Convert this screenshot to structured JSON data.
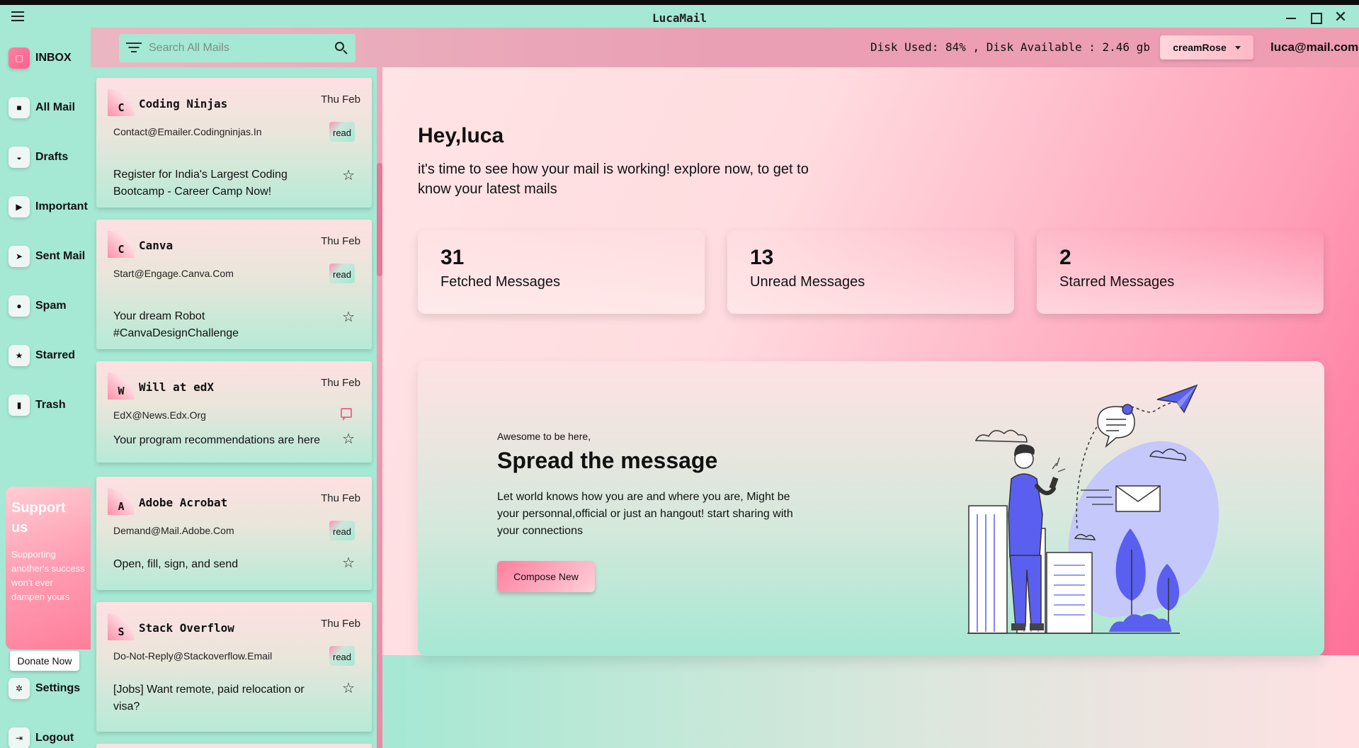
{
  "window": {
    "title": "LucaMail",
    "close_glyph": "✕"
  },
  "sidebar": {
    "items": [
      {
        "label": "INBOX",
        "icon": "inbox-icon",
        "glyph": "▢"
      },
      {
        "label": "All Mail",
        "icon": "folder-icon",
        "glyph": "■"
      },
      {
        "label": "Drafts",
        "icon": "drafts-icon",
        "glyph": "◒"
      },
      {
        "label": "Important",
        "icon": "important-icon",
        "glyph": "▶"
      },
      {
        "label": "Sent Mail",
        "icon": "send-icon",
        "glyph": "➤"
      },
      {
        "label": "Spam",
        "icon": "spam-icon",
        "glyph": "●"
      },
      {
        "label": "Starred",
        "icon": "star-icon",
        "glyph": "★"
      },
      {
        "label": "Trash",
        "icon": "trash-icon",
        "glyph": "▮"
      }
    ],
    "support": {
      "title": "Support us",
      "text": "Supporting another's success won't ever dampen yours",
      "button": "Donate Now"
    },
    "settings": {
      "label": "Settings",
      "icon": "gear-icon",
      "glyph": "✲"
    },
    "logout": {
      "label": "Logout",
      "icon": "logout-icon",
      "glyph": "⇥"
    }
  },
  "header": {
    "search_placeholder": "Search All Mails",
    "disk_info": "Disk Used: 84% , Disk Available : 2.46 gb",
    "theme": "creamRose",
    "user_email": "luca@mail.com"
  },
  "mails": [
    {
      "initial": "C",
      "sender": "Coding Ninjas",
      "date": "Thu Feb",
      "from": "Contact@Emailer.Codingninjas.In",
      "status": "read",
      "subject": "Register for India's Largest Coding Bootcamp - Career Camp Now!",
      "star": "☆"
    },
    {
      "initial": "C",
      "sender": "Canva",
      "date": "Thu Feb",
      "from": "Start@Engage.Canva.Com",
      "status": "read",
      "subject": "Your dream Robot #CanvaDesignChallenge",
      "star": "☆"
    },
    {
      "initial": "W",
      "sender": "Will at edX",
      "date": "Thu Feb",
      "from": "EdX@News.Edx.Org",
      "status": "",
      "subject": "Your program recommendations are here",
      "star": "☆"
    },
    {
      "initial": "A",
      "sender": "Adobe Acrobat",
      "date": "Thu Feb",
      "from": "Demand@Mail.Adobe.Com",
      "status": "read",
      "subject": "Open, fill, sign, and send",
      "star": "☆"
    },
    {
      "initial": "S",
      "sender": "Stack Overflow",
      "date": "Thu Feb",
      "from": "Do-Not-Reply@Stackoverflow.Email",
      "status": "read",
      "subject": "[Jobs] Want remote, paid relocation or visa?",
      "star": "☆"
    }
  ],
  "main": {
    "greeting": "Hey,luca",
    "subtitle": "it's time to see how your mail is working! explore now, to get to know your latest mails",
    "stats": [
      {
        "value": "31",
        "label": "Fetched Messages"
      },
      {
        "value": "13",
        "label": "Unread Messages"
      },
      {
        "value": "2",
        "label": "Starred Messages"
      }
    ],
    "promo": {
      "kicker": "Awesome to be here,",
      "title": "Spread the message",
      "body": "Let world knows how you are and where you are, Might be your personnal,official or just an hangout! start sharing with your connections",
      "button": "Compose New"
    }
  },
  "colors": {
    "mint": "#a5e8d3",
    "rose": "#ff6994",
    "illustration_blue": "#5a5ff0"
  }
}
